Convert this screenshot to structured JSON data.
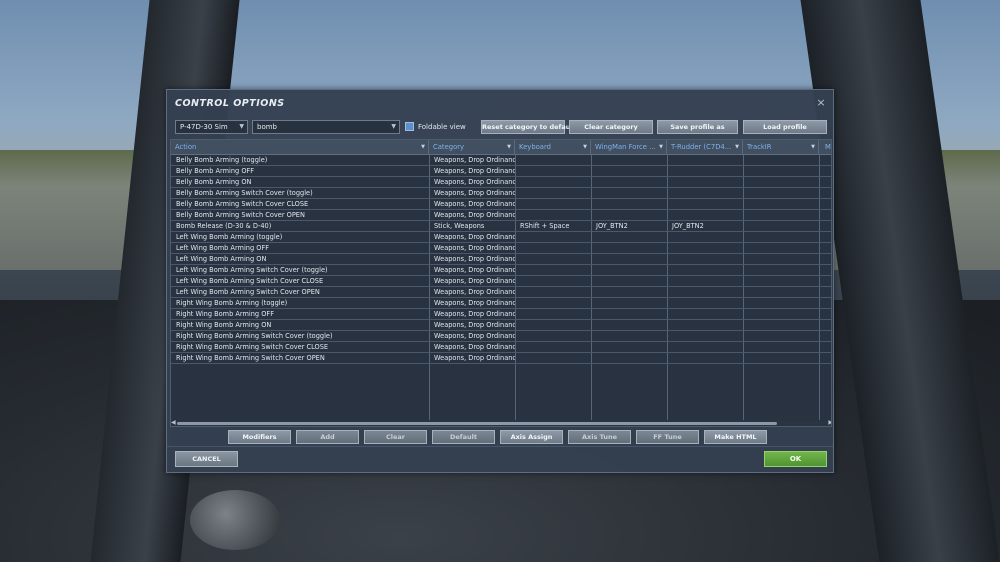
{
  "dialog": {
    "title": "CONTROL OPTIONS",
    "close_glyph": "×",
    "profile_select": "P-47D-30 Sim",
    "search_value": "bomb",
    "foldable_label": "Foldable view",
    "foldable_checked": true,
    "top_buttons": {
      "reset": "Reset category to default",
      "clear_category": "Clear category",
      "save_profile": "Save profile as",
      "load_profile": "Load profile"
    },
    "columns": [
      "Action",
      "Category",
      "Keyboard",
      "WingMan Force ...",
      "T-Rudder  (C7D4...",
      "TrackIR",
      "Mo"
    ],
    "rows": [
      [
        "Belly Bomb Arming (toggle)",
        "Weapons, Drop Ordinance",
        "",
        "",
        ""
      ],
      [
        "Belly Bomb Arming OFF",
        "Weapons, Drop Ordinance",
        "",
        "",
        ""
      ],
      [
        "Belly Bomb Arming ON",
        "Weapons, Drop Ordinance",
        "",
        "",
        ""
      ],
      [
        "Belly Bomb Arming Switch Cover (toggle)",
        "Weapons, Drop Ordinance",
        "",
        "",
        ""
      ],
      [
        "Belly Bomb Arming Switch Cover CLOSE",
        "Weapons, Drop Ordinance",
        "",
        "",
        ""
      ],
      [
        "Belly Bomb Arming Switch Cover OPEN",
        "Weapons, Drop Ordinance",
        "",
        "",
        ""
      ],
      [
        "Bomb Release (D-30 & D-40)",
        "Stick, Weapons",
        "RShift + Space",
        "JOY_BTN2",
        "JOY_BTN2"
      ],
      [
        "Left Wing Bomb Arming (toggle)",
        "Weapons, Drop Ordinance",
        "",
        "",
        ""
      ],
      [
        "Left Wing Bomb Arming OFF",
        "Weapons, Drop Ordinance",
        "",
        "",
        ""
      ],
      [
        "Left Wing Bomb Arming ON",
        "Weapons, Drop Ordinance",
        "",
        "",
        ""
      ],
      [
        "Left Wing Bomb Arming Switch Cover (toggle)",
        "Weapons, Drop Ordinance",
        "",
        "",
        ""
      ],
      [
        "Left Wing Bomb Arming Switch Cover CLOSE",
        "Weapons, Drop Ordinance",
        "",
        "",
        ""
      ],
      [
        "Left Wing Bomb Arming Switch Cover OPEN",
        "Weapons, Drop Ordinance",
        "",
        "",
        ""
      ],
      [
        "Right Wing Bomb Arming (toggle)",
        "Weapons, Drop Ordinance",
        "",
        "",
        ""
      ],
      [
        "Right Wing Bomb Arming OFF",
        "Weapons, Drop Ordinance",
        "",
        "",
        ""
      ],
      [
        "Right Wing Bomb Arming ON",
        "Weapons, Drop Ordinance",
        "",
        "",
        ""
      ],
      [
        "Right Wing Bomb Arming Switch Cover (toggle)",
        "Weapons, Drop Ordinance",
        "",
        "",
        ""
      ],
      [
        "Right Wing Bomb Arming Switch Cover CLOSE",
        "Weapons, Drop Ordinance",
        "",
        "",
        ""
      ],
      [
        "Right Wing Bomb Arming Switch Cover OPEN",
        "Weapons, Drop Ordinance",
        "",
        "",
        ""
      ]
    ],
    "bottom_buttons": [
      "Modifiers",
      "Add",
      "Clear",
      "Default",
      "Axis Assign",
      "Axis Tune",
      "FF Tune",
      "Make HTML"
    ],
    "cancel_label": "CANCEL",
    "ok_label": "OK",
    "colors": {
      "ok_green": "#5fa53b",
      "header_text": "#7eb3ea",
      "panel": "#344050"
    }
  }
}
